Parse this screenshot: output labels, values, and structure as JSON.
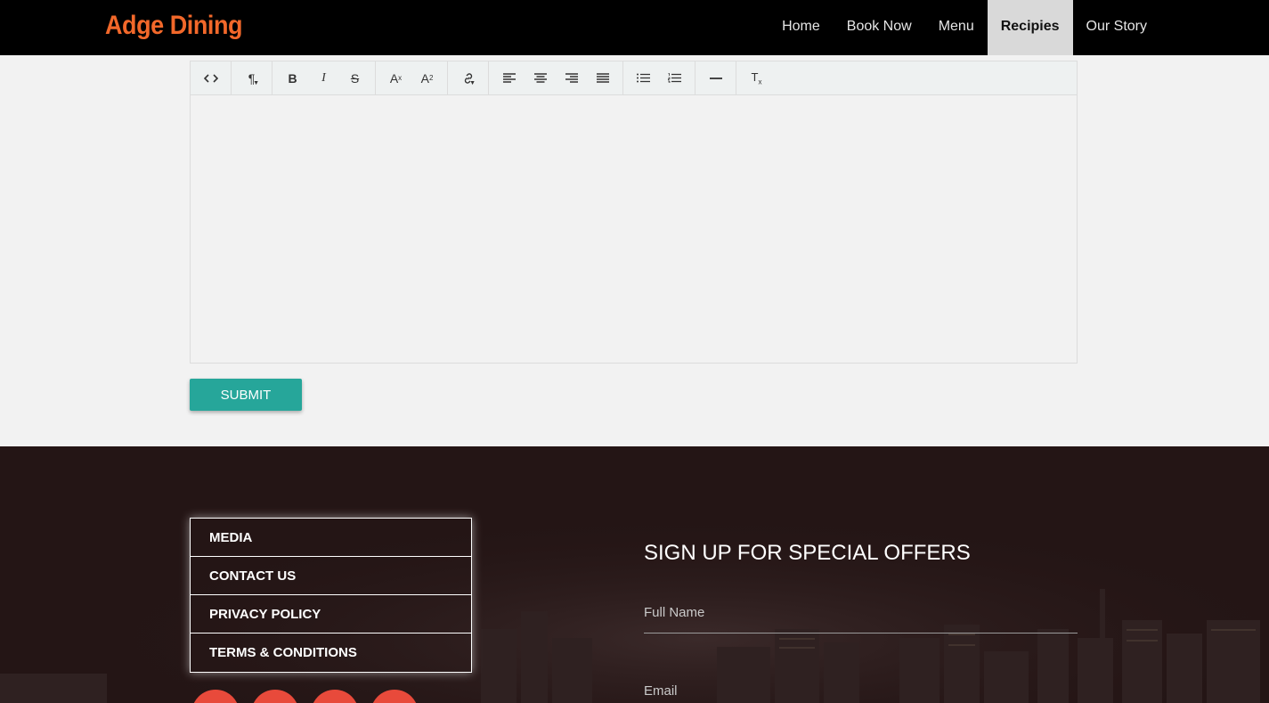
{
  "brand": {
    "logo": "Adge Dining",
    "accent": "#f2682a"
  },
  "nav": {
    "items": [
      {
        "label": "Home",
        "active": false
      },
      {
        "label": "Book Now",
        "active": false
      },
      {
        "label": "Menu",
        "active": false
      },
      {
        "label": "Recipies",
        "active": true
      },
      {
        "label": "Our Story",
        "active": false
      }
    ]
  },
  "editor": {
    "toolbar": [
      {
        "icon": "code-view-icon",
        "glyph": "<>"
      },
      {
        "icon": "paragraph-format-icon",
        "glyph": "¶"
      },
      {
        "icon": "bold-icon",
        "glyph": "B"
      },
      {
        "icon": "italic-icon",
        "glyph": "I"
      },
      {
        "icon": "strikethrough-icon",
        "glyph": "S"
      },
      {
        "icon": "superscript-icon",
        "glyph": "A²"
      },
      {
        "icon": "subscript-icon",
        "glyph": "A₂"
      },
      {
        "icon": "link-icon",
        "glyph": "🔗"
      },
      {
        "icon": "align-left-icon",
        "glyph": "≡"
      },
      {
        "icon": "align-center-icon",
        "glyph": "≡"
      },
      {
        "icon": "align-right-icon",
        "glyph": "≡"
      },
      {
        "icon": "align-justify-icon",
        "glyph": "≡"
      },
      {
        "icon": "bulleted-list-icon",
        "glyph": "•"
      },
      {
        "icon": "numbered-list-icon",
        "glyph": "1."
      },
      {
        "icon": "horizontal-rule-icon",
        "glyph": "—"
      },
      {
        "icon": "clear-format-icon",
        "glyph": "Tx"
      }
    ],
    "content": ""
  },
  "form": {
    "submit_label": "SUBMIT",
    "submit_color": "#26a69a"
  },
  "footer": {
    "links": [
      "MEDIA",
      "CONTACT US",
      "PRIVACY POLICY",
      "TERMS & CONDITIONS"
    ],
    "social_color": "#e84a3b",
    "signup": {
      "title": "SIGN UP FOR SPECIAL OFFERS",
      "name_placeholder": "Full Name",
      "email_placeholder": "Email"
    }
  }
}
